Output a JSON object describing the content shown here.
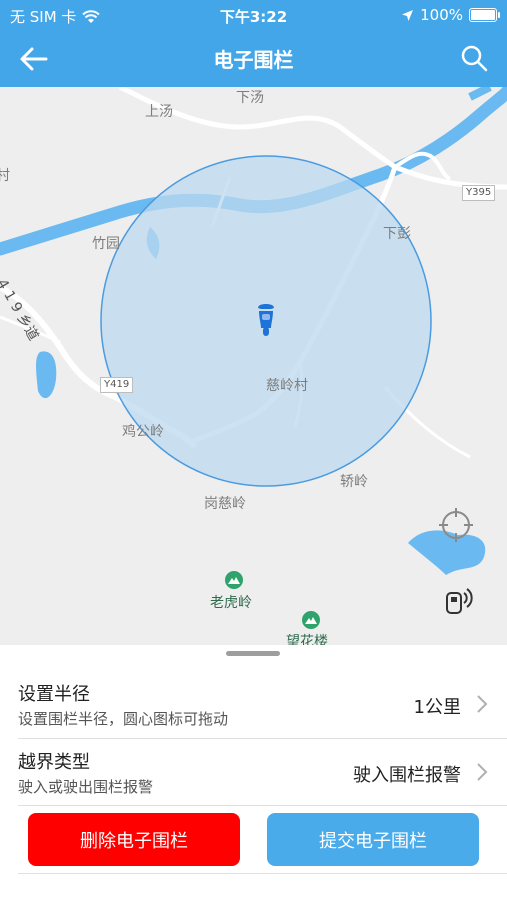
{
  "status_bar": {
    "carrier": "无 SIM 卡",
    "time": "下午3:22",
    "battery": "100%"
  },
  "nav": {
    "title": "电子围栏",
    "back_icon": "arrow-left-icon",
    "search_icon": "search-icon"
  },
  "map": {
    "places": {
      "shangtang": "上汤",
      "xiatang": "下汤",
      "zhuyuan": "竹园",
      "xiapeng": "下彭",
      "ciling_village": "慈岭村",
      "jigongling": "鸡公岭",
      "jiaoling": "轿岭",
      "gangciling": "岗慈岭",
      "cun": "村",
      "road_419": "4 1 9 乡道"
    },
    "road_tags": {
      "y395": "Y395",
      "y419": "Y419"
    },
    "pois": {
      "laohuling": "老虎岭",
      "wanghualou": "望花楼"
    },
    "fence_center_icon": "scooter-icon",
    "locate_icon": "crosshair-icon",
    "device_icon": "device-signal-icon",
    "colors": {
      "fence_fill": "#bcd9ef",
      "fence_stroke": "#4a9be0",
      "water": "#6ab9f0"
    }
  },
  "settings": {
    "radius": {
      "label": "设置半径",
      "description": "设置围栏半径，圆心图标可拖动",
      "value": "1公里"
    },
    "boundary": {
      "label": "越界类型",
      "description": "驶入或驶出围栏报警",
      "value": "驶入围栏报警"
    }
  },
  "buttons": {
    "delete": "删除电子围栏",
    "submit": "提交电子围栏"
  }
}
